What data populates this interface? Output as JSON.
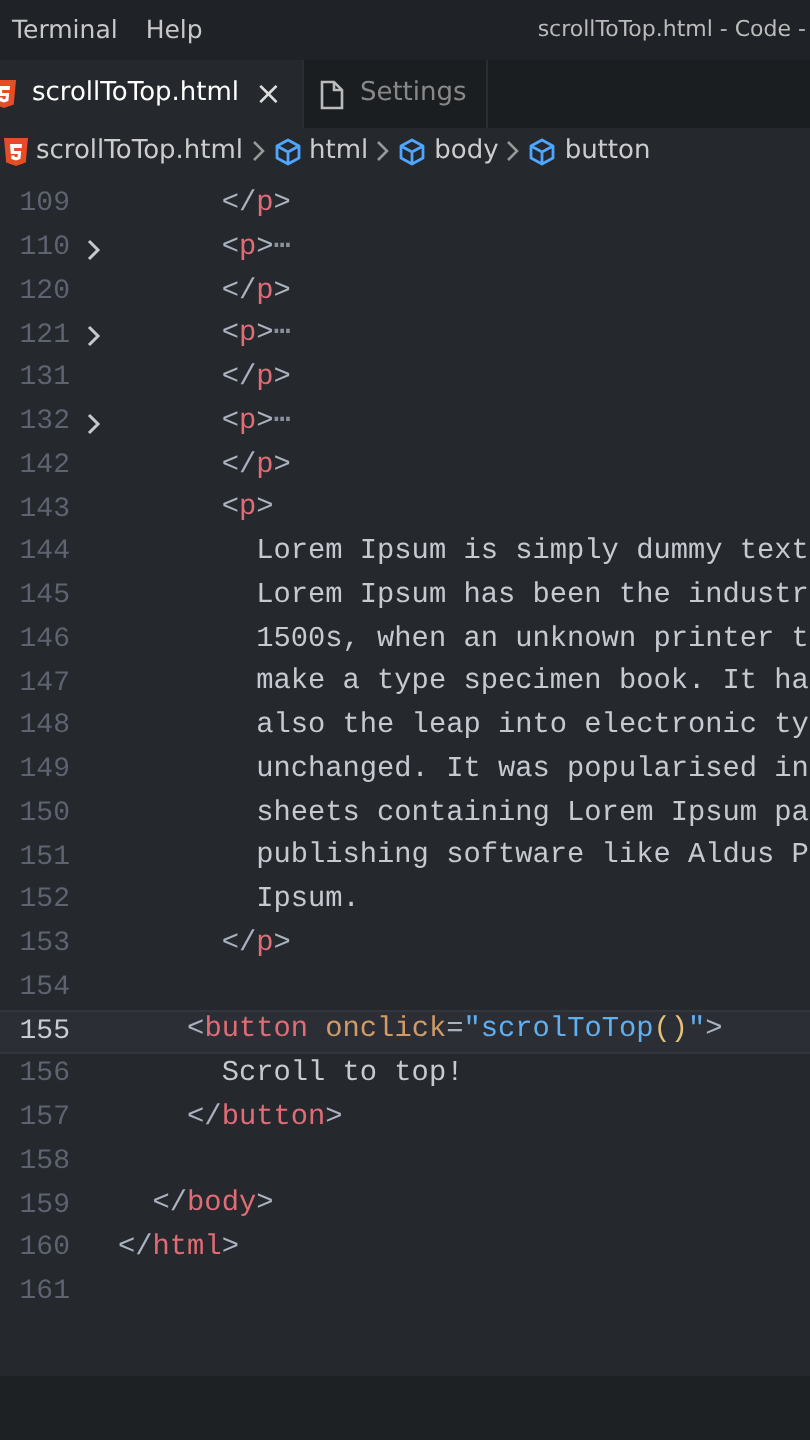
{
  "menu": [
    "Terminal",
    "Help"
  ],
  "window": {
    "title": "scrollToTop.html - Code -"
  },
  "tabs": [
    {
      "label": "scrollToTop.html",
      "selected": true,
      "close": "×"
    },
    {
      "label": "Settings",
      "selected": false
    }
  ],
  "breadcrumb": [
    {
      "label": "scrollToTop.html"
    },
    {
      "label": "html"
    },
    {
      "label": "body"
    },
    {
      "label": "button"
    }
  ],
  "lines": [
    {
      "number": "109",
      "current": false,
      "tokens": [
        {
          "kind": "punct",
          "text": "      </"
        },
        {
          "kind": "tag",
          "text": "p"
        },
        {
          "kind": "punct",
          "text": ">"
        }
      ]
    },
    {
      "number": "110",
      "folded": true,
      "current": false,
      "tokens": [
        {
          "kind": "punct",
          "text": "      <"
        },
        {
          "kind": "tag",
          "text": "p"
        },
        {
          "kind": "punct",
          "text": ">"
        },
        {
          "kind": "fold",
          "text": "⋯"
        }
      ]
    },
    {
      "number": "120",
      "current": false,
      "tokens": [
        {
          "kind": "punct",
          "text": "      </"
        },
        {
          "kind": "tag",
          "text": "p"
        },
        {
          "kind": "punct",
          "text": ">"
        }
      ]
    },
    {
      "number": "121",
      "folded": true,
      "current": false,
      "tokens": [
        {
          "kind": "punct",
          "text": "      <"
        },
        {
          "kind": "tag",
          "text": "p"
        },
        {
          "kind": "punct",
          "text": ">"
        },
        {
          "kind": "fold",
          "text": "⋯"
        }
      ]
    },
    {
      "number": "131",
      "current": false,
      "tokens": [
        {
          "kind": "punct",
          "text": "      </"
        },
        {
          "kind": "tag",
          "text": "p"
        },
        {
          "kind": "punct",
          "text": ">"
        }
      ]
    },
    {
      "number": "132",
      "folded": true,
      "current": false,
      "tokens": [
        {
          "kind": "punct",
          "text": "      <"
        },
        {
          "kind": "tag",
          "text": "p"
        },
        {
          "kind": "punct",
          "text": ">"
        },
        {
          "kind": "fold",
          "text": "⋯"
        }
      ]
    },
    {
      "number": "142",
      "current": false,
      "tokens": [
        {
          "kind": "punct",
          "text": "      </"
        },
        {
          "kind": "tag",
          "text": "p"
        },
        {
          "kind": "punct",
          "text": ">"
        }
      ]
    },
    {
      "number": "143",
      "current": false,
      "tokens": [
        {
          "kind": "punct",
          "text": "      <"
        },
        {
          "kind": "tag",
          "text": "p"
        },
        {
          "kind": "punct",
          "text": ">"
        }
      ]
    },
    {
      "number": "144",
      "current": false,
      "tokens": [
        {
          "kind": "text",
          "text": "        Lorem Ipsum is simply dummy text"
        }
      ]
    },
    {
      "number": "145",
      "current": false,
      "tokens": [
        {
          "kind": "text",
          "text": "        Lorem Ipsum has been the industr"
        }
      ]
    },
    {
      "number": "146",
      "current": false,
      "tokens": [
        {
          "kind": "text",
          "text": "        1500s, when an unknown printer t"
        }
      ]
    },
    {
      "number": "147",
      "current": false,
      "tokens": [
        {
          "kind": "text",
          "text": "        make a type specimen book. It ha"
        }
      ]
    },
    {
      "number": "148",
      "current": false,
      "tokens": [
        {
          "kind": "text",
          "text": "        also the leap into electronic ty"
        }
      ]
    },
    {
      "number": "149",
      "current": false,
      "tokens": [
        {
          "kind": "text",
          "text": "        unchanged. It was popularised in"
        }
      ]
    },
    {
      "number": "150",
      "current": false,
      "tokens": [
        {
          "kind": "text",
          "text": "        sheets containing Lorem Ipsum pa"
        }
      ]
    },
    {
      "number": "151",
      "current": false,
      "tokens": [
        {
          "kind": "text",
          "text": "        publishing software like Aldus P"
        }
      ]
    },
    {
      "number": "152",
      "current": false,
      "tokens": [
        {
          "kind": "text",
          "text": "        Ipsum."
        }
      ]
    },
    {
      "number": "153",
      "current": false,
      "tokens": [
        {
          "kind": "punct",
          "text": "      </"
        },
        {
          "kind": "tag",
          "text": "p"
        },
        {
          "kind": "punct",
          "text": ">"
        }
      ]
    },
    {
      "number": "154",
      "current": false
    },
    {
      "number": "155",
      "current": true,
      "tokens": [
        {
          "kind": "punct",
          "text": "    <"
        },
        {
          "kind": "tag",
          "text": "button"
        },
        {
          "kind": "attr",
          "text": " onclick"
        },
        {
          "kind": "punct",
          "text": "="
        },
        {
          "kind": "str",
          "text": "\"scrolToTop"
        },
        {
          "kind": "paren",
          "text": "()"
        },
        {
          "kind": "str",
          "text": "\""
        },
        {
          "kind": "punct",
          "text": ">"
        }
      ]
    },
    {
      "number": "156",
      "current": false,
      "tokens": [
        {
          "kind": "text",
          "text": "      Scroll to top!"
        }
      ]
    },
    {
      "number": "157",
      "current": false,
      "tokens": [
        {
          "kind": "punct",
          "text": "    </"
        },
        {
          "kind": "tag",
          "text": "button"
        },
        {
          "kind": "punct",
          "text": ">"
        }
      ]
    },
    {
      "number": "158",
      "current": false
    },
    {
      "number": "159",
      "current": false,
      "tokens": [
        {
          "kind": "punct",
          "text": "  </"
        },
        {
          "kind": "tag",
          "text": "body"
        },
        {
          "kind": "punct",
          "text": ">"
        }
      ]
    },
    {
      "number": "160",
      "current": false,
      "tokens": [
        {
          "kind": "punct",
          "text": "</"
        },
        {
          "kind": "tag",
          "text": "html"
        },
        {
          "kind": "punct",
          "text": ">"
        }
      ]
    },
    {
      "number": "161",
      "current": false
    }
  ]
}
